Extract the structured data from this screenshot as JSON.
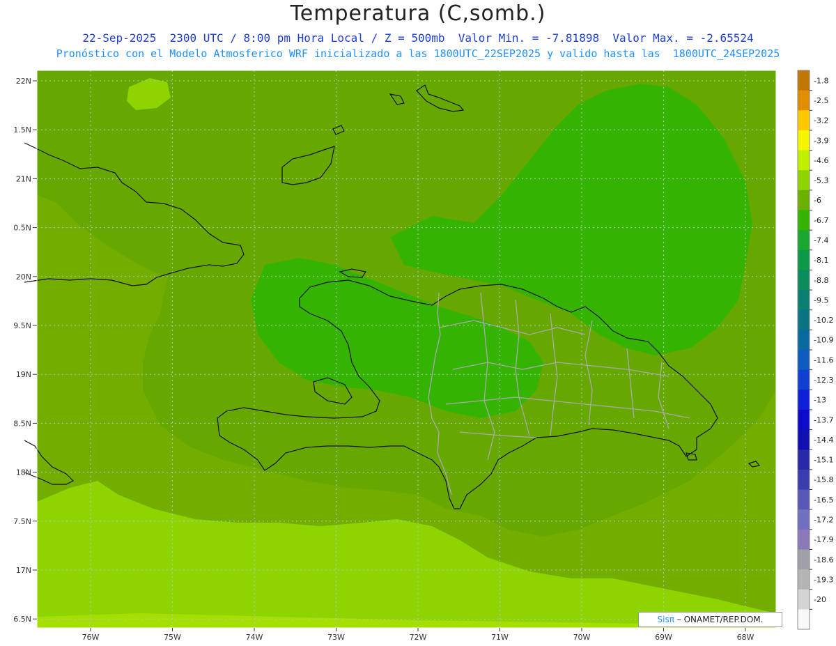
{
  "title": "Temperatura (C,somb.)",
  "subtitle_line1": "22-Sep-2025  2300 UTC / 8:00 pm Hora Local / Z = 500mb  Valor Min. = -7.81898  Valor Max. = -2.65524",
  "subtitle_line2": "Pronóstico con el Modelo Atmosferico WRF inicializado a las 1800UTC_22SEP2025 y valido hasta las  1800UTC_24SEP2025",
  "lat_labels": [
    "22N",
    "1.5N",
    "21N",
    "0.5N",
    "20N",
    "9.5N",
    "19N",
    "8.5N",
    "18N",
    "7.5N",
    "17N",
    "6.5N"
  ],
  "lon_labels": [
    "76W",
    "75W",
    "74W",
    "73W",
    "72W",
    "71W",
    "70W",
    "69W",
    "68W"
  ],
  "colorbar": {
    "labels": [
      "-1.8",
      "-2.5",
      "-3.2",
      "-3.9",
      "-4.6",
      "-5.3",
      "-6",
      "-6.7",
      "-7.4",
      "-8.1",
      "-8.8",
      "-9.5",
      "-10.2",
      "-10.9",
      "-11.6",
      "-12.3",
      "-13",
      "-13.7",
      "-14.4",
      "-15.1",
      "-15.8",
      "-16.5",
      "-17.2",
      "-17.9",
      "-18.6",
      "-19.3",
      "-20"
    ],
    "colors": [
      "#c07800",
      "#e08e00",
      "#ffc800",
      "#f5f500",
      "#c0f000",
      "#8ed400",
      "#6cb000",
      "#34b400",
      "#18a830",
      "#0c9a48",
      "#0a8c5c",
      "#0a8070",
      "#0a7484",
      "#0a6aa0",
      "#0e5cc0",
      "#1040d0",
      "#1020d8",
      "#0c0cc8",
      "#1010b0",
      "#2828a8",
      "#3c3cb0",
      "#5858b8",
      "#7070c0",
      "#8a78b8",
      "#a0a0a8",
      "#b4b4b4",
      "#d4d4d4",
      "#f8f8f8"
    ]
  },
  "map_colors": {
    "ocean_main": "#72ad00",
    "ocean_mid": "#66a800",
    "warm_band": "#8ed400",
    "warm_far": "#a4df00",
    "cool_pool": "#34b400",
    "cool_core": "#18a830",
    "coast": "#111111",
    "border": "#aaaaaa",
    "grid": "#b8c8b8"
  },
  "credit": {
    "sis": "Sisπ",
    "text": " – ONAMET/REP.DOM."
  }
}
